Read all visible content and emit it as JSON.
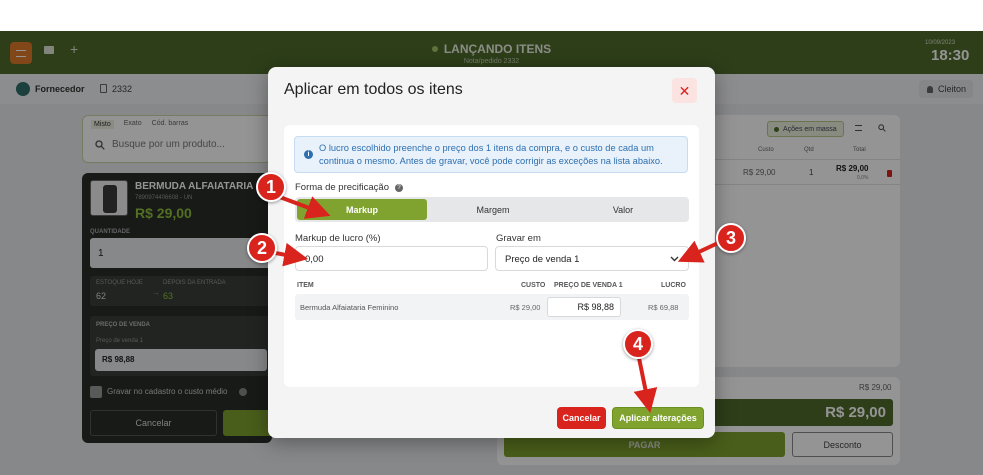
{
  "header": {
    "title": "LANÇANDO ITENS",
    "subtitle": "Nota/pedido 2332",
    "date": "10/09/2023",
    "time": "18:30"
  },
  "subbar": {
    "supplier_label": "Fornecedor",
    "doc_number": "2332",
    "user": "Cleiton"
  },
  "search": {
    "tabs": [
      "Misto",
      "Exato",
      "Cód. barras"
    ],
    "placeholder": "Busque por um produto..."
  },
  "product": {
    "name": "BERMUDA ALFAIATARIA",
    "code": "7890974406608 - UN",
    "price": "R$ 29,00",
    "qty_label": "QUANTIDADE",
    "qty_value": "1",
    "stock_today_label": "ESTOQUE HOJE",
    "stock_today": "62",
    "after_entry_label": "DEPOIS DA ENTRADA",
    "after_entry": "63",
    "sale_price_label": "PREÇO DE VENDA",
    "sale_price_sub": "Preço de venda 1",
    "sale_price_value": "R$ 98,88",
    "checkbox_label": "Gravar no cadastro o custo médio",
    "cancel": "Cancelar"
  },
  "list": {
    "bulk_actions": "Ações em massa",
    "columns": [
      "Custo",
      "Qtd",
      "Total"
    ],
    "row": {
      "cost": "R$ 29,00",
      "qty": "1",
      "total": "R$ 29,00",
      "pct": "0,0%"
    }
  },
  "footer": {
    "small_total": "R$ 29,00",
    "big_total": "R$ 29,00",
    "pay": "PAGAR",
    "discount": "Desconto"
  },
  "modal": {
    "title": "Aplicar em todos os itens",
    "info": "O lucro escolhido preenche o preço dos 1 itens da compra, e o custo de cada um continua o mesmo. Antes de gravar, você pode corrigir as exceções na lista abaixo.",
    "pricing_label": "Forma de precificação",
    "pricing_options": [
      "Markup",
      "Margem",
      "Valor"
    ],
    "markup_label": "Markup de lucro (%)",
    "markup_value": "0,00",
    "save_in_label": "Gravar em",
    "save_in_value": "Preço de venda 1",
    "table_headers": {
      "item": "ITEM",
      "cost": "CUSTO",
      "price": "PREÇO DE VENDA 1",
      "profit": "LUCRO"
    },
    "table_row": {
      "item": "Bermuda Alfaiataria Feminino",
      "cost": "R$ 29,00",
      "price": "R$ 98,88",
      "profit": "R$ 69,88"
    },
    "cancel": "Cancelar",
    "apply": "Aplicar alterações"
  },
  "markers": [
    "1",
    "2",
    "3",
    "4"
  ],
  "colors": {
    "brand_green": "#4f6b2c",
    "accent_green": "#7fa32e",
    "danger": "#d9231d",
    "info_blue": "#2d6fb0"
  }
}
